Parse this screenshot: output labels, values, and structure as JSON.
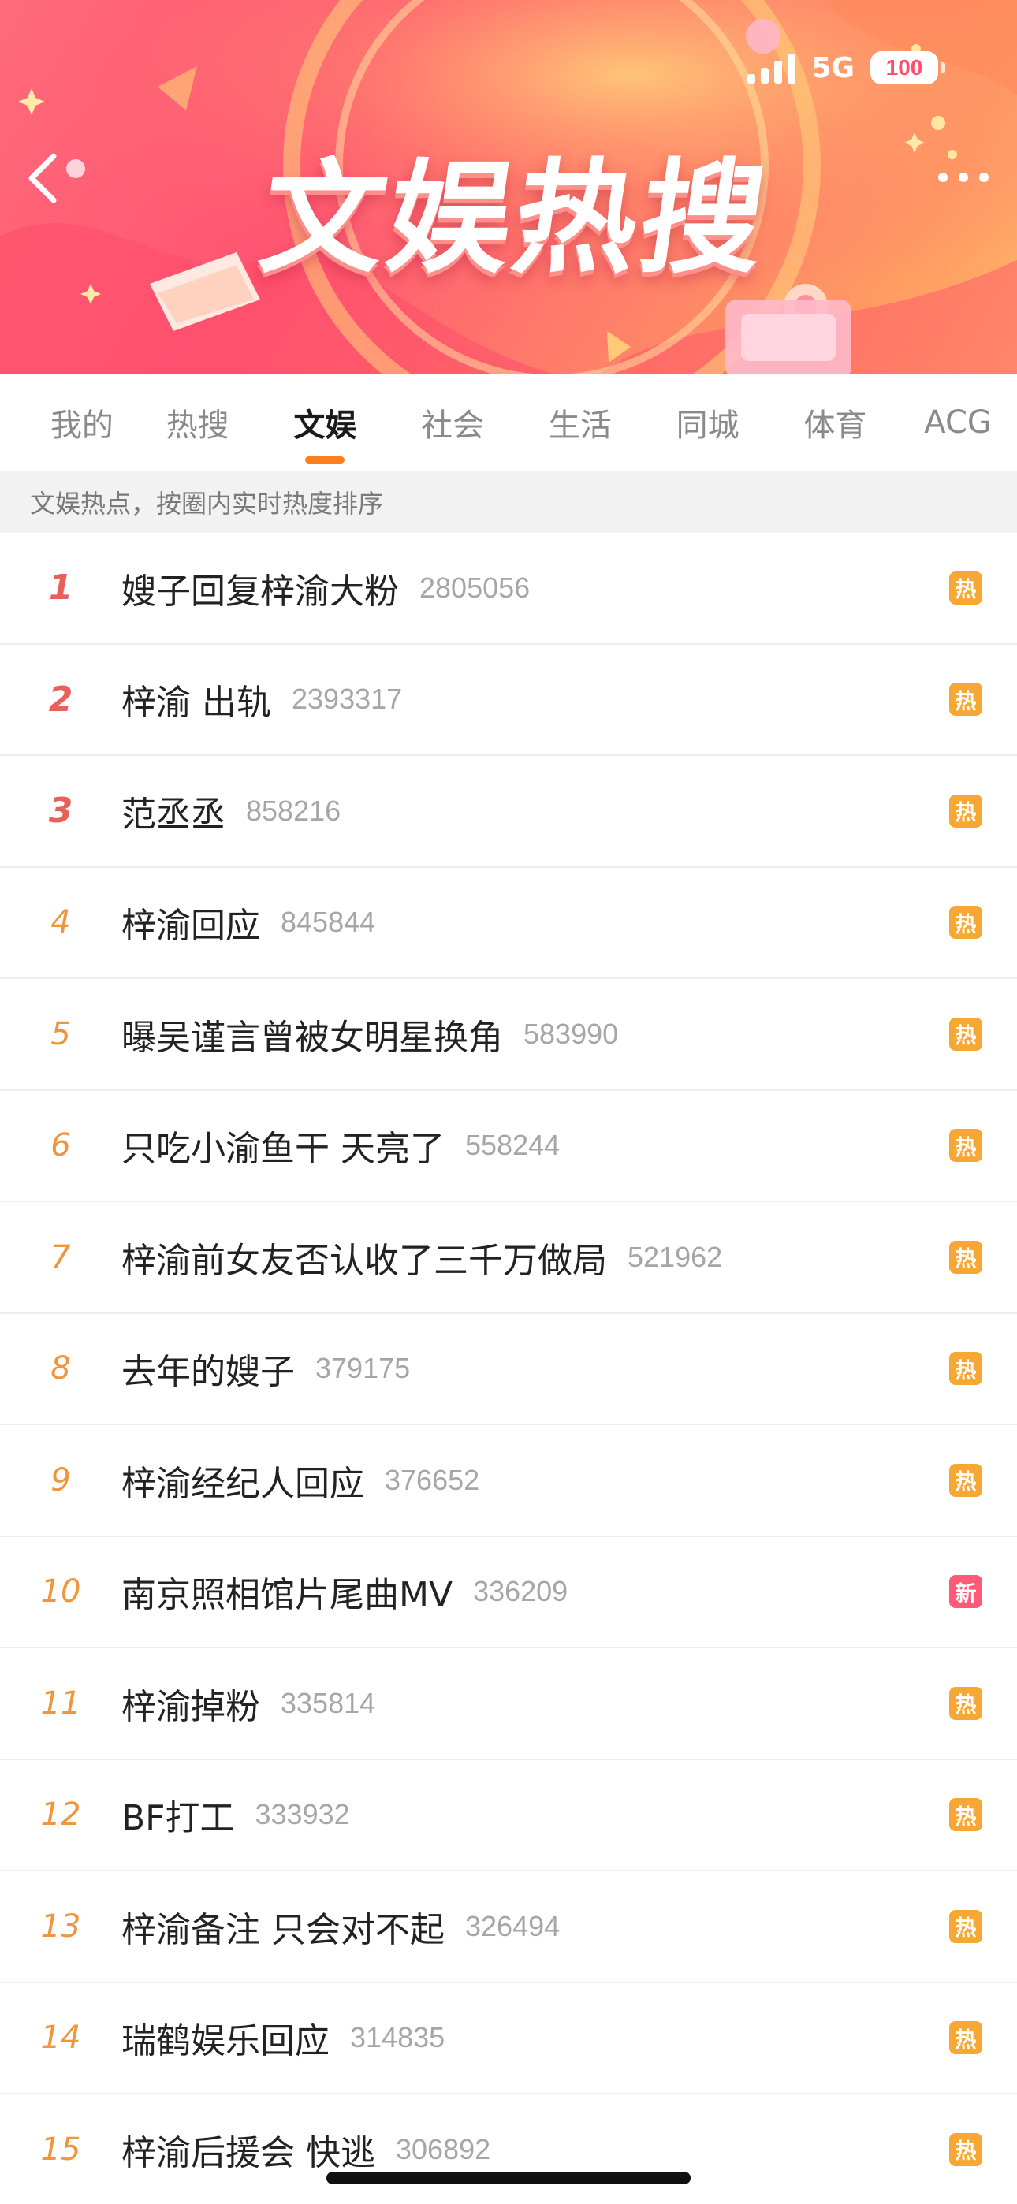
{
  "status_bar": {
    "network": "5G",
    "battery": "100"
  },
  "header": {
    "title": "文娱热搜"
  },
  "tabs": [
    {
      "label": "我的",
      "active": false
    },
    {
      "label": "热搜",
      "active": false
    },
    {
      "label": "文娱",
      "active": true
    },
    {
      "label": "社会",
      "active": false
    },
    {
      "label": "生活",
      "active": false
    },
    {
      "label": "同城",
      "active": false
    },
    {
      "label": "体育",
      "active": false
    },
    {
      "label": "ACG",
      "active": false
    }
  ],
  "notice": "文娱热点，按圈内实时热度排序",
  "colors": {
    "accent": "#ff7e1f",
    "hot_badge": "#f7a733",
    "new_badge": "#ff5a77",
    "top_rank": "#e8605a",
    "rank": "#f0953b"
  },
  "items": [
    {
      "rank": "1",
      "title": "嫂子回复梓渝大粉",
      "heat": "2805056",
      "badge": "热",
      "badge_type": "hot"
    },
    {
      "rank": "2",
      "title": "梓渝 出轨",
      "heat": "2393317",
      "badge": "热",
      "badge_type": "hot"
    },
    {
      "rank": "3",
      "title": "范丞丞",
      "heat": "858216",
      "badge": "热",
      "badge_type": "hot"
    },
    {
      "rank": "4",
      "title": "梓渝回应",
      "heat": "845844",
      "badge": "热",
      "badge_type": "hot"
    },
    {
      "rank": "5",
      "title": "曝吴谨言曾被女明星换角",
      "heat": "583990",
      "badge": "热",
      "badge_type": "hot"
    },
    {
      "rank": "6",
      "title": "只吃小渝鱼干 天亮了",
      "heat": "558244",
      "badge": "热",
      "badge_type": "hot"
    },
    {
      "rank": "7",
      "title": "梓渝前女友否认收了三千万做局",
      "heat": "521962",
      "badge": "热",
      "badge_type": "hot"
    },
    {
      "rank": "8",
      "title": "去年的嫂子",
      "heat": "379175",
      "badge": "热",
      "badge_type": "hot"
    },
    {
      "rank": "9",
      "title": "梓渝经纪人回应",
      "heat": "376652",
      "badge": "热",
      "badge_type": "hot"
    },
    {
      "rank": "10",
      "title": "南京照相馆片尾曲MV",
      "heat": "336209",
      "badge": "新",
      "badge_type": "new"
    },
    {
      "rank": "11",
      "title": "梓渝掉粉",
      "heat": "335814",
      "badge": "热",
      "badge_type": "hot"
    },
    {
      "rank": "12",
      "title": "BF打工",
      "heat": "333932",
      "badge": "热",
      "badge_type": "hot"
    },
    {
      "rank": "13",
      "title": "梓渝备注 只会对不起",
      "heat": "326494",
      "badge": "热",
      "badge_type": "hot"
    },
    {
      "rank": "14",
      "title": "瑞鹤娱乐回应",
      "heat": "314835",
      "badge": "热",
      "badge_type": "hot"
    },
    {
      "rank": "15",
      "title": "梓渝后援会 快逃",
      "heat": "306892",
      "badge": "热",
      "badge_type": "hot"
    }
  ]
}
